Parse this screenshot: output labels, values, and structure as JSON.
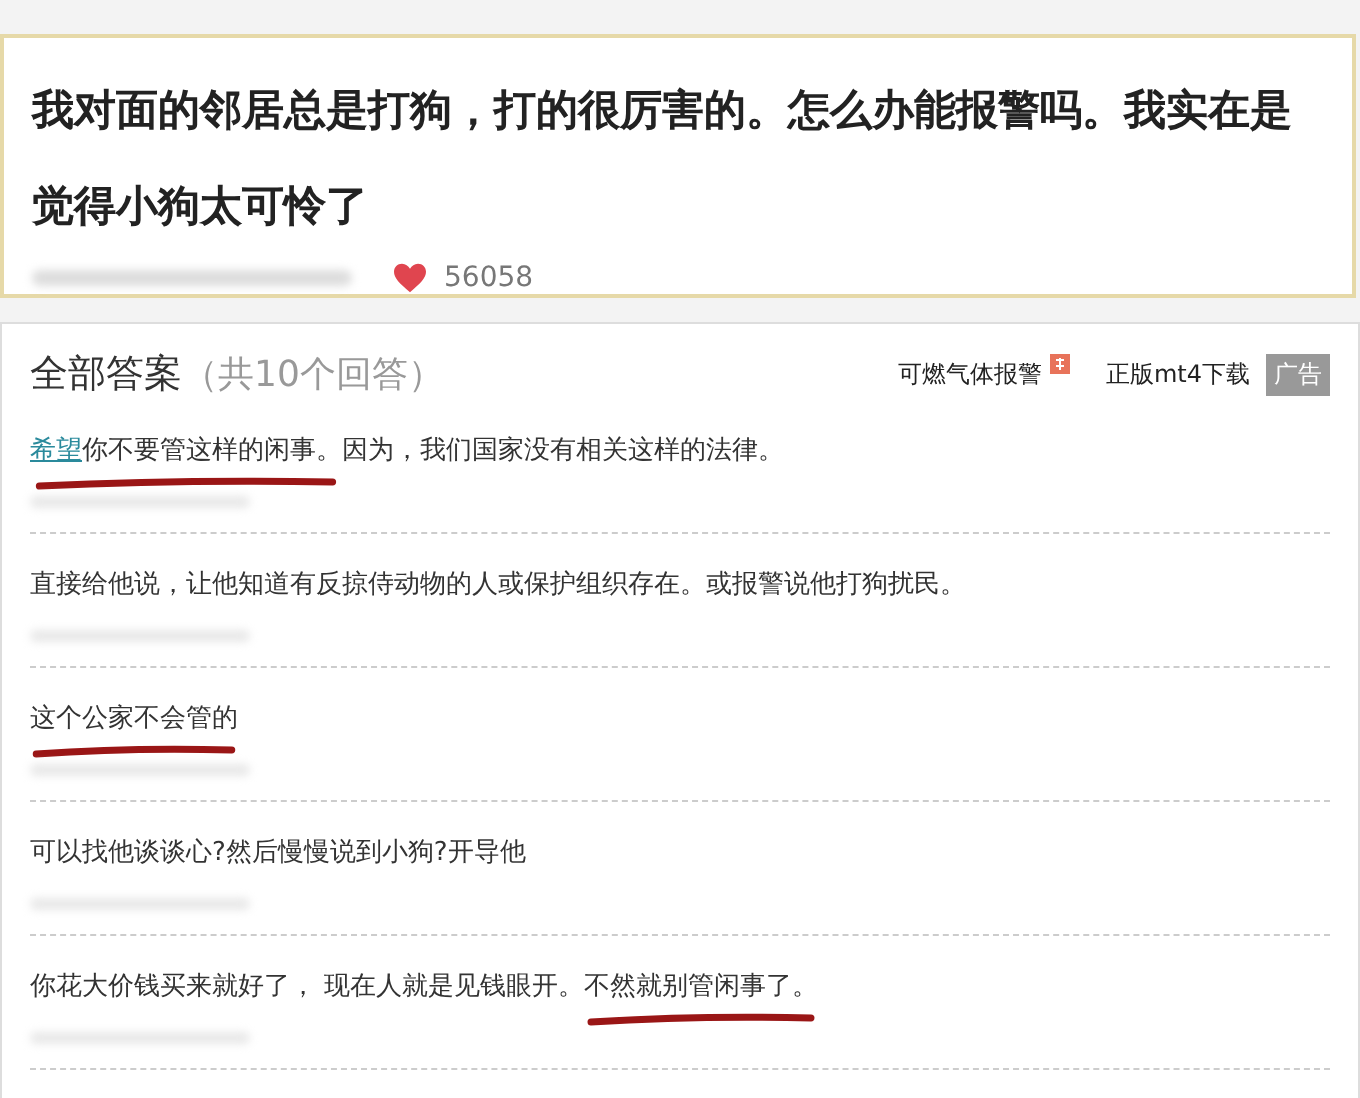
{
  "question": {
    "title": "我对面的邻居总是打狗，打的很厉害的。怎么办能报警吗。我实在是觉得小狗太可怜了",
    "likes": "56058"
  },
  "answers_header": {
    "title": "全部答案",
    "count": "（共10个回答）"
  },
  "ads": {
    "links": [
      "可燃气体报警",
      "正版mt4下载"
    ],
    "tag": "广告"
  },
  "answers": [
    {
      "parts": [
        {
          "text": "希望",
          "link": true,
          "marked": true
        },
        {
          "text": "你不要管这样的闲事。",
          "link": false,
          "marked": true
        },
        {
          "text": "因为，我们国家没有相关这样的法律。",
          "link": false,
          "marked": false
        }
      ]
    },
    {
      "parts": [
        {
          "text": "直接给他说，让他知道有反掠侍动物的人或保护组织存在。或报警说他打狗扰民。",
          "link": false,
          "marked": false
        }
      ]
    },
    {
      "parts": [
        {
          "text": "这个公家不会管的",
          "link": false,
          "marked": true
        }
      ]
    },
    {
      "parts": [
        {
          "text": "可以找他谈谈心?然后慢慢说到小狗?开导他",
          "link": false,
          "marked": false
        }
      ]
    },
    {
      "parts": [
        {
          "text": "你花大价钱买来就好了， 现在人就是见钱眼开。",
          "link": false,
          "marked": false
        },
        {
          "text": "不然就别管闲事了。",
          "link": false,
          "marked": true
        }
      ]
    }
  ]
}
